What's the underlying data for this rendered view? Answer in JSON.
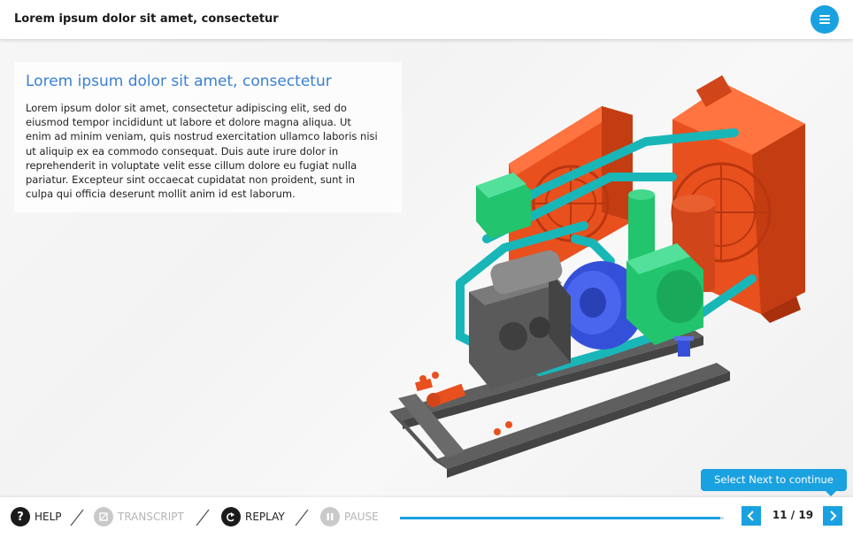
{
  "header": {
    "title": "Lorem ipsum dolor sit amet, consectetur",
    "menu_icon": "menu-icon"
  },
  "content": {
    "heading": "Lorem ipsum dolor sit amet, consectetur",
    "body": "Lorem ipsum dolor sit amet, consectetur adipiscing elit, sed do eiusmod tempor incididunt ut labore et dolore magna aliqua. Ut enim ad minim veniam, quis nostrud exercitation ullamco laboris nisi ut aliquip ex ea commodo consequat. Duis aute irure dolor in reprehenderit in voluptate velit esse cillum dolore eu fugiat nulla pariatur. Excepteur sint occaecat cupidatat non proident, sunt in culpa qui officia deserunt mollit anim id est laborum."
  },
  "tooltip": {
    "text": "Select Next to continue"
  },
  "controls": {
    "help": "HELP",
    "transcript": "TRANSCRIPT",
    "replay": "REPLAY",
    "pause": "PAUSE"
  },
  "navigation": {
    "page_indicator": "11 / 19",
    "current_page": 11,
    "total_pages": 19,
    "progress": 0.99
  },
  "colors": {
    "accent": "#1aa1e0",
    "heading": "#3a7fd6",
    "radiator": "#e8501e",
    "pipes": "#19b6b8",
    "motor": "#22c46e",
    "pump": "#3550d8",
    "frame": "#666666"
  }
}
